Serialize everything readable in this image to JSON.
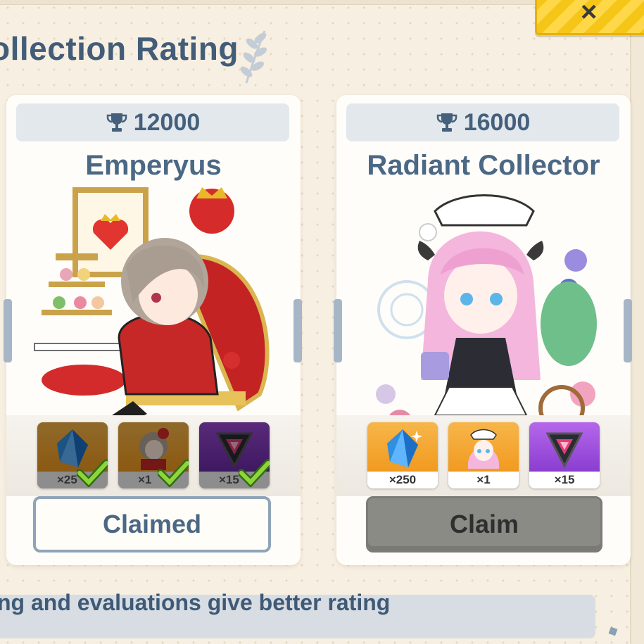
{
  "header": {
    "title": "ollection Rating",
    "close_label": "×"
  },
  "cards": [
    {
      "rating": "12000",
      "name": "Emperyus",
      "rewards": [
        {
          "icon": "crystal-icon",
          "qty": "×25",
          "claimed": true
        },
        {
          "icon": "avatar-icon",
          "qty": "×1",
          "claimed": true
        },
        {
          "icon": "triangle-core-icon",
          "qty": "×15",
          "claimed": true
        }
      ],
      "button_label": "Claimed"
    },
    {
      "rating": "16000",
      "name": "Radiant Collector",
      "rewards": [
        {
          "icon": "crystal-icon",
          "qty": "×250",
          "claimed": false
        },
        {
          "icon": "avatar-icon",
          "qty": "×1",
          "claimed": false
        },
        {
          "icon": "triangle-core-icon",
          "qty": "×15",
          "claimed": false
        }
      ],
      "button_label": "Claim"
    }
  ],
  "footer": {
    "hint": "ng and evaluations give better rating"
  },
  "colors": {
    "accent_text": "#45607c",
    "background": "#f7efe1",
    "close_button": "#f5c518",
    "claim_button": "#8b8b86"
  }
}
